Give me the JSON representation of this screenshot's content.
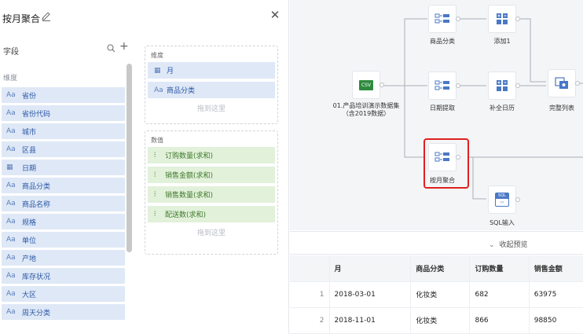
{
  "panel": {
    "title": "按月聚合",
    "fields_label": "字段",
    "dim_group_label": "维度",
    "fields": [
      {
        "type": "Aa",
        "name": "省份"
      },
      {
        "type": "Aa",
        "name": "省份代码"
      },
      {
        "type": "Aa",
        "name": "城市"
      },
      {
        "type": "Aa",
        "name": "区县"
      },
      {
        "type": "date",
        "name": "日期"
      },
      {
        "type": "Aa",
        "name": "商品分类"
      },
      {
        "type": "Aa",
        "name": "商品名称"
      },
      {
        "type": "Aa",
        "name": "规格"
      },
      {
        "type": "Aa",
        "name": "单位"
      },
      {
        "type": "Aa",
        "name": "产地"
      },
      {
        "type": "Aa",
        "name": "库存状况"
      },
      {
        "type": "Aa",
        "name": "大区"
      },
      {
        "type": "Aa",
        "name": "周天分类"
      }
    ],
    "dims_label": "维度",
    "dims": [
      {
        "type": "date",
        "name": "月"
      },
      {
        "type": "Aa",
        "name": "商品分类"
      }
    ],
    "dims_hint": "拖到这里",
    "measures_label": "数值",
    "measures": [
      {
        "name": "订购数量(求和)"
      },
      {
        "name": "销售金额(求和)"
      },
      {
        "name": "销售数量(求和)"
      },
      {
        "name": "配送数(求和)"
      }
    ],
    "measures_hint": "拖到这里"
  },
  "canvas": {
    "nodes": {
      "csv": {
        "label": "01.产品培训演示数据集（含2019数据）",
        "badge": "CSV"
      },
      "category": {
        "label": "商品分类"
      },
      "add1": {
        "label": "添加1"
      },
      "date_extract": {
        "label": "日期提取"
      },
      "fill_calendar": {
        "label": "补全日历"
      },
      "full_list": {
        "label": "完整列表"
      },
      "month_agg": {
        "label": "按月聚合"
      },
      "sql_input": {
        "label": "SQL输入",
        "badge": "SQL"
      }
    }
  },
  "preview": {
    "toggle_label": "收起预览",
    "columns": [
      "月",
      "商品分类",
      "订购数量",
      "销售金额"
    ],
    "rows": [
      {
        "index": "1",
        "cells": [
          "2018-03-01",
          "化妆类",
          "682",
          "63975"
        ]
      },
      {
        "index": "2",
        "cells": [
          "2018-11-01",
          "化妆类",
          "866",
          "98850"
        ]
      }
    ]
  },
  "colors": {
    "dimension_chip": "#dfe8f6",
    "measure_chip": "#e2f1da",
    "selection": "#e02020",
    "canvas_bg": "#f4f5f7"
  }
}
